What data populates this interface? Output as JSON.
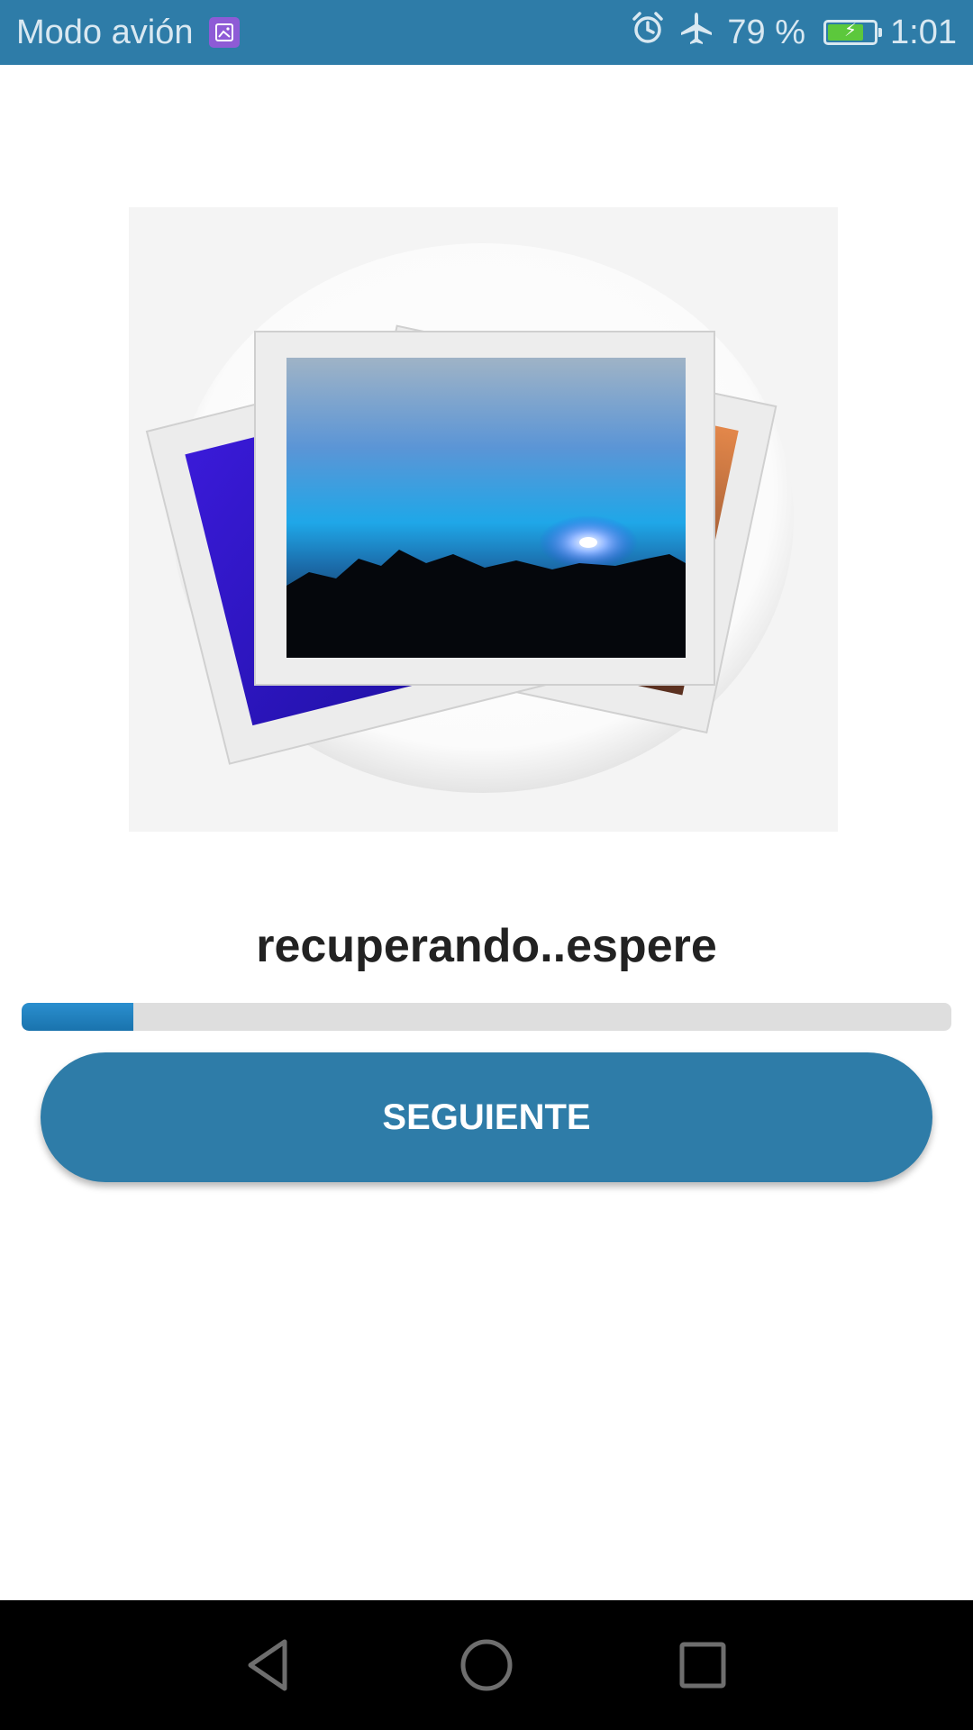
{
  "status_bar": {
    "mode_label": "Modo avión",
    "notification_icon": "gallery-icon",
    "alarm_icon": "alarm-icon",
    "airplane_icon": "airplane-icon",
    "battery_percent": "79 %",
    "battery_level": 0.79,
    "time": "1:01"
  },
  "hero_image": {
    "icon": "photo-stack-icon"
  },
  "main": {
    "status_text": "recuperando..espere",
    "progress": 0.12,
    "next_label": "SEGUIENTE"
  },
  "nav_bar": {
    "back_icon": "back-icon",
    "home_icon": "home-icon",
    "recents_icon": "recents-icon"
  },
  "colors": {
    "accent": "#2e7ca8",
    "progress_fill": "#1f80bf",
    "progress_track": "#dedede",
    "nav_background": "#000000"
  }
}
